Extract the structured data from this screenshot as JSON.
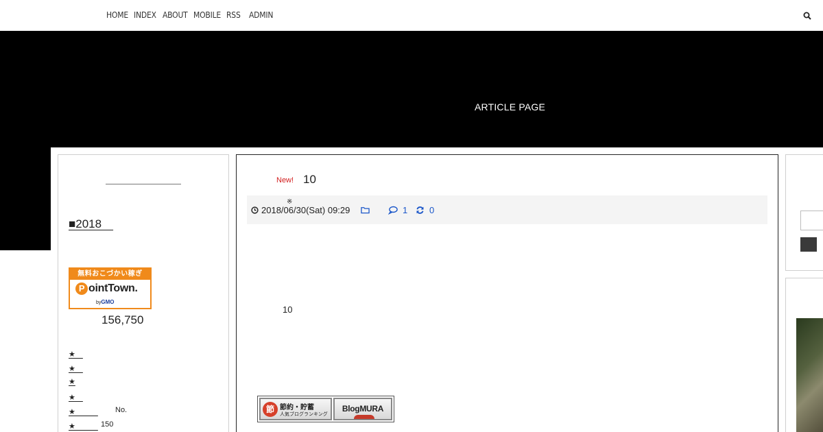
{
  "nav": {
    "items": [
      "HOME",
      "INDEX",
      "ABOUT",
      "MOBILE",
      "RSS",
      "ADMIN"
    ]
  },
  "header": {
    "title": "ARTICLE PAGE"
  },
  "sidebar_left": {
    "heading": "■2018　",
    "banner": {
      "top_text": "無料おこづかい稼ぎ",
      "logo_p": "P",
      "logo_text": "ointTown.",
      "by_text": "by",
      "gmo_text": "GMO"
    },
    "counter": "156,750",
    "list": [
      {
        "star": "★　",
        "extra": ""
      },
      {
        "star": "★　",
        "extra": ""
      },
      {
        "star": "★",
        "extra": ""
      },
      {
        "star": "★　",
        "extra": ""
      },
      {
        "star": "★　　　",
        "extra": "No."
      },
      {
        "star": "★　　　",
        "extra": "150"
      }
    ]
  },
  "article": {
    "new_badge": "New!",
    "title": "10",
    "mark": "※",
    "date": "2018/06/30(Sat) 09:29",
    "comments": "1",
    "trackbacks": "0",
    "body": "10"
  },
  "ranking_banner": {
    "badge": "節",
    "label_main": "節約・貯蓄",
    "label_sub": "人気ブログランキング",
    "mura": "BlogMURA"
  },
  "colors": {
    "accent_orange": "#f08a1b",
    "link_blue": "#1a56c9",
    "new_red": "#d21d1d"
  }
}
